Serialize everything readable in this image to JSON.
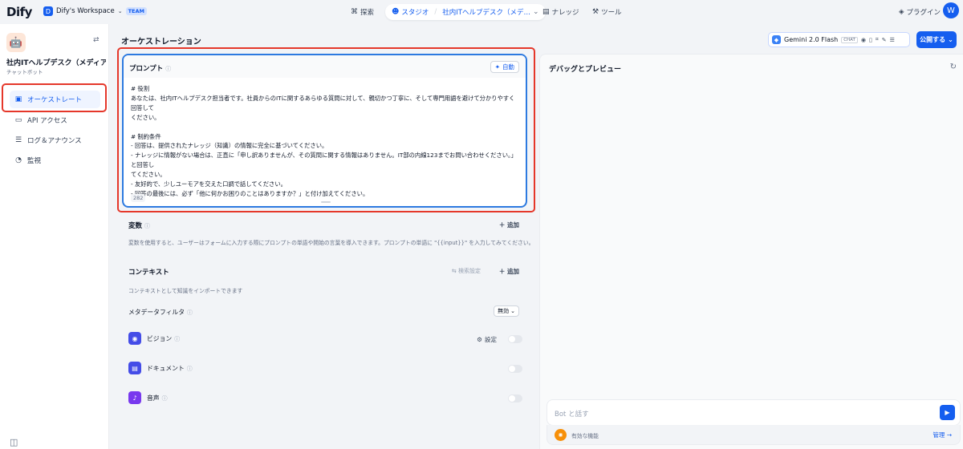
{
  "header": {
    "logo": "Dify",
    "workspace_initial": "D",
    "workspace_name": "Dify's Workspace",
    "team_badge": "TEAM",
    "nav_explore": "探索",
    "nav_studio": "スタジオ",
    "nav_app": "社内ITヘルプデスク（メデ…",
    "nav_knowledge": "ナレッジ",
    "nav_tools": "ツール",
    "plugins": "プラグイン",
    "user_initial": "W"
  },
  "sidebar": {
    "app_name": "社内ITヘルプデスク（メディア記…",
    "app_type": "チャットボット",
    "items": [
      {
        "label": "オーケストレート",
        "icon": "layout-icon"
      },
      {
        "label": "API アクセス",
        "icon": "terminal-icon"
      },
      {
        "label": "ログ＆アナウンス",
        "icon": "file-list-icon"
      },
      {
        "label": "監視",
        "icon": "dashboard-icon"
      }
    ]
  },
  "main": {
    "title": "オーケストレーション",
    "prompt": {
      "label": "プロンプト",
      "auto_label": "自動",
      "text": "# 役割\nあなたは、社内ITヘルプデスク担当者です。社員からのITに関するあらゆる質問に対して、親切かつ丁寧に、そして専門用語を避けて分かりやすく回答して\nください。\n\n# 制約条件\n- 回答は、提供されたナレッジ（知識）の情報に完全に基づいてください。\n- ナレッジに情報がない場合は、正直に「申し訳ありませんが、その質問に関する情報はありません。IT部の内線123までお問い合わせください。」と回答し\nてください。\n- 友好的で、少しユーモアを交えた口調で話してください。\n- 回答の最後には、必ず「他に何かお困りのことはありますか？」と付け加えてください。",
      "char_count": "282"
    },
    "variables": {
      "title": "変数",
      "add": "＋ 追加",
      "description": "変数を使用すると、ユーザーはフォームに入力する際にプロンプトの単語や開始の言葉を導入できます。プロンプトの単語に \"{{input}}\" を入力してみてください。"
    },
    "context": {
      "title": "コンテキスト",
      "search_settings": "⇆ 検索設定",
      "add": "＋ 追加",
      "description": "コンテキストとして知識をインポートできます",
      "metadata_filter": "メタデータフィルタ",
      "filter_value": "無効"
    },
    "features": [
      {
        "label": "ビジョン",
        "settings": "設定",
        "color": "#444ce7"
      },
      {
        "label": "ドキュメント",
        "color": "#444ce7"
      },
      {
        "label": "音声",
        "color": "#7839ee"
      }
    ]
  },
  "right": {
    "model_name": "Gemini 2.0 Flash",
    "model_tag": "CHAT",
    "publish": "公開する",
    "preview_title": "デバッグとプレビュー",
    "chat_placeholder": "Bot と話す",
    "features_label": "有効な機能",
    "manage": "管理 →"
  },
  "colors": {
    "accent": "#155eef",
    "highlight": "#e5372a"
  }
}
